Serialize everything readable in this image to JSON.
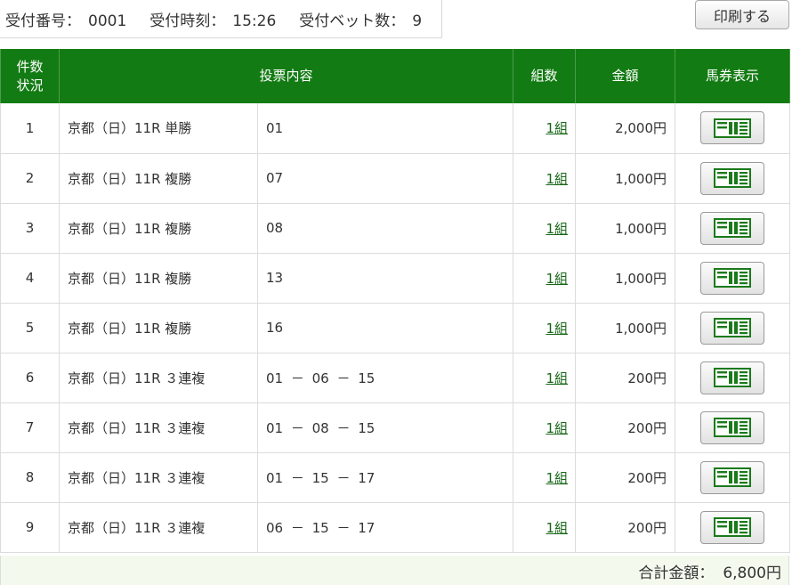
{
  "header": {
    "receipt_no_label": "受付番号：",
    "receipt_no": "0001",
    "receipt_time_label": "受付時刻：",
    "receipt_time": "15:26",
    "bet_count_label": "受付ベット数：",
    "bet_count": "9"
  },
  "print_label": "印刷する",
  "columns": {
    "no_line1": "件数",
    "no_line2": "状況",
    "content": "投票内容",
    "kumi": "組数",
    "amount": "金額",
    "ticket": "馬券表示"
  },
  "rows": [
    {
      "no": "1",
      "race": "京都（日）11R 単勝",
      "selection": "01",
      "kumi": "1組",
      "amount": "2,000円"
    },
    {
      "no": "2",
      "race": "京都（日）11R 複勝",
      "selection": "07",
      "kumi": "1組",
      "amount": "1,000円"
    },
    {
      "no": "3",
      "race": "京都（日）11R 複勝",
      "selection": "08",
      "kumi": "1組",
      "amount": "1,000円"
    },
    {
      "no": "4",
      "race": "京都（日）11R 複勝",
      "selection": "13",
      "kumi": "1組",
      "amount": "1,000円"
    },
    {
      "no": "5",
      "race": "京都（日）11R 複勝",
      "selection": "16",
      "kumi": "1組",
      "amount": "1,000円"
    },
    {
      "no": "6",
      "race": "京都（日）11R ３連複",
      "selection": "01 － 06 － 15",
      "kumi": "1組",
      "amount": "200円"
    },
    {
      "no": "7",
      "race": "京都（日）11R ３連複",
      "selection": "01 － 08 － 15",
      "kumi": "1組",
      "amount": "200円"
    },
    {
      "no": "8",
      "race": "京都（日）11R ３連複",
      "selection": "01 － 15 － 17",
      "kumi": "1組",
      "amount": "200円"
    },
    {
      "no": "9",
      "race": "京都（日）11R ３連複",
      "selection": "06 － 15 － 17",
      "kumi": "1組",
      "amount": "200円"
    }
  ],
  "ticket_icon": "ticket-icon",
  "total": {
    "label": "合計金額：",
    "value": "6,800円"
  },
  "colors": {
    "header_green": "#137b13",
    "link_green": "#166616",
    "icon_green": "#1a7a1a",
    "total_bg": "#f4f9ee"
  }
}
